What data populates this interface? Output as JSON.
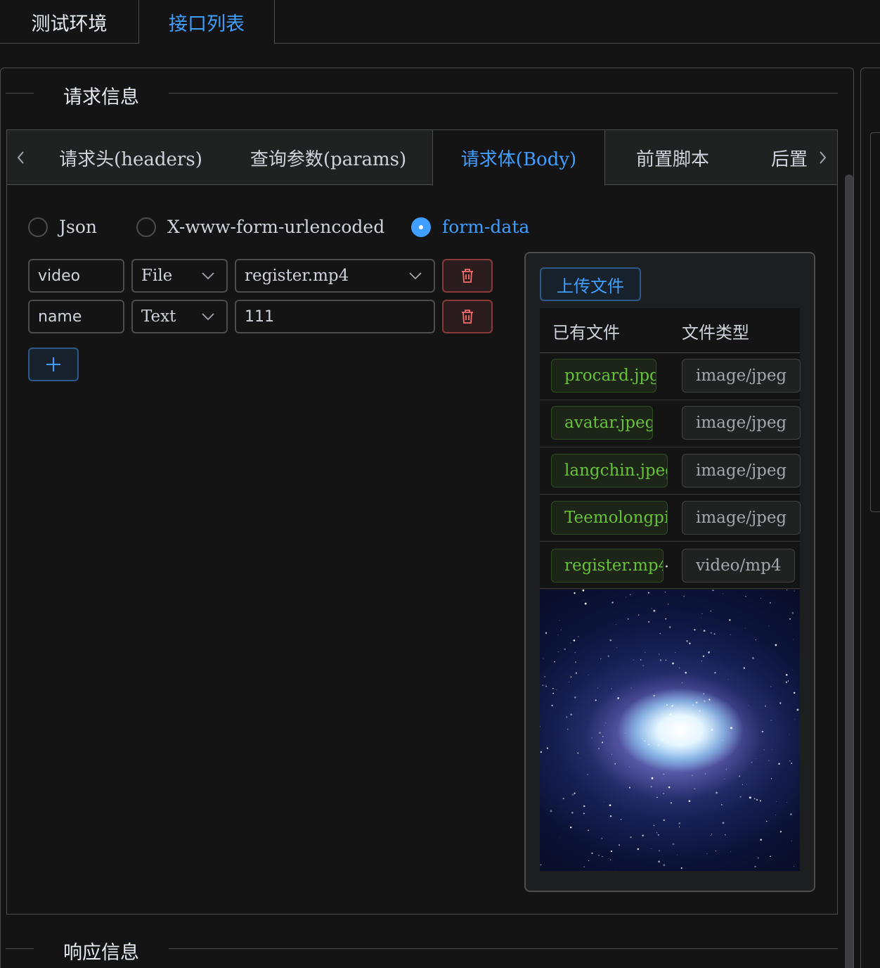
{
  "top_tabs": [
    "测试环境",
    "接口列表"
  ],
  "sections": {
    "request_title": "请求信息",
    "response_title": "响应信息"
  },
  "request_tabs": {
    "items": [
      "请求头(headers)",
      "查询参数(params)",
      "请求体(Body)",
      "前置脚本",
      "后置"
    ],
    "active": "请求体(Body)"
  },
  "body_type": {
    "options": [
      "Json",
      "X-www-form-urlencoded",
      "form-data"
    ],
    "selected": "form-data"
  },
  "form_rows": [
    {
      "key": "video",
      "type": "File",
      "value": "register.mp4"
    },
    {
      "key": "name",
      "type": "Text",
      "value": "111"
    }
  ],
  "file_panel": {
    "upload_label": "上传文件",
    "col_file": "已有文件",
    "col_type": "文件类型",
    "files": [
      {
        "name": "procard.jpg",
        "type": "image/jpeg"
      },
      {
        "name": "avatar.jpeg",
        "type": "image/jpeg"
      },
      {
        "name": "langchin.jpeg",
        "type": "image/jpeg"
      },
      {
        "name": "Teemolongpicn",
        "type": "image/jpeg"
      },
      {
        "name": "register.mp4",
        "type": "video/mp4"
      }
    ],
    "preview": "galaxy-image"
  },
  "icons": {
    "delete": "trash-icon",
    "add": "plus-icon",
    "select": "chevron-down-icon",
    "prev": "chevron-left-icon",
    "next": "chevron-right-icon"
  },
  "colors": {
    "accent": "#409eff",
    "danger": "#f56c6c",
    "success": "#67c23a",
    "background": "#141414"
  }
}
